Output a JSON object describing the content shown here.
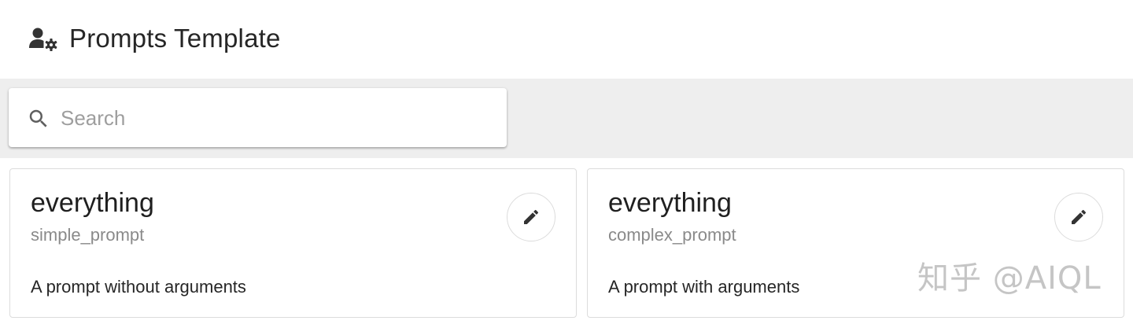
{
  "header": {
    "title": "Prompts Template",
    "icon": "manage-accounts-icon"
  },
  "search": {
    "placeholder": "Search",
    "value": "",
    "icon": "search-icon"
  },
  "cards": [
    {
      "title": "everything",
      "subtitle": "simple_prompt",
      "description": "A prompt without arguments",
      "action_icon": "edit-icon"
    },
    {
      "title": "everything",
      "subtitle": "complex_prompt",
      "description": "A prompt with arguments",
      "action_icon": "edit-icon"
    }
  ],
  "watermark": "知乎 @AIQL",
  "colors": {
    "toolbar_bg": "#eeeeee",
    "card_border": "#dcdcdc",
    "subtitle": "#8a8a8a",
    "icon": "#333333"
  }
}
